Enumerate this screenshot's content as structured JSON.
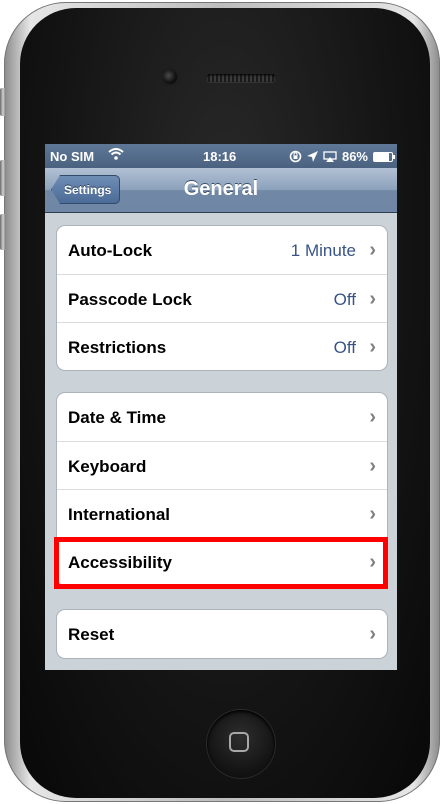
{
  "status_bar": {
    "carrier": "No SIM",
    "wifi_icon": "wifi-icon",
    "time": "18:16",
    "battery": "86%",
    "battery_level": 0.86
  },
  "nav": {
    "back_label": "Settings",
    "title": "General"
  },
  "groups": [
    {
      "rows": [
        {
          "label": "Auto-Lock",
          "value": "1 Minute"
        },
        {
          "label": "Passcode Lock",
          "value": "Off"
        },
        {
          "label": "Restrictions",
          "value": "Off"
        }
      ]
    },
    {
      "rows": [
        {
          "label": "Date & Time",
          "value": ""
        },
        {
          "label": "Keyboard",
          "value": ""
        },
        {
          "label": "International",
          "value": ""
        },
        {
          "label": "Accessibility",
          "value": ""
        }
      ]
    },
    {
      "rows": [
        {
          "label": "Reset",
          "value": ""
        }
      ]
    }
  ],
  "chevron": "›",
  "highlight": {
    "target": "Accessibility",
    "color": "#ff0000"
  }
}
